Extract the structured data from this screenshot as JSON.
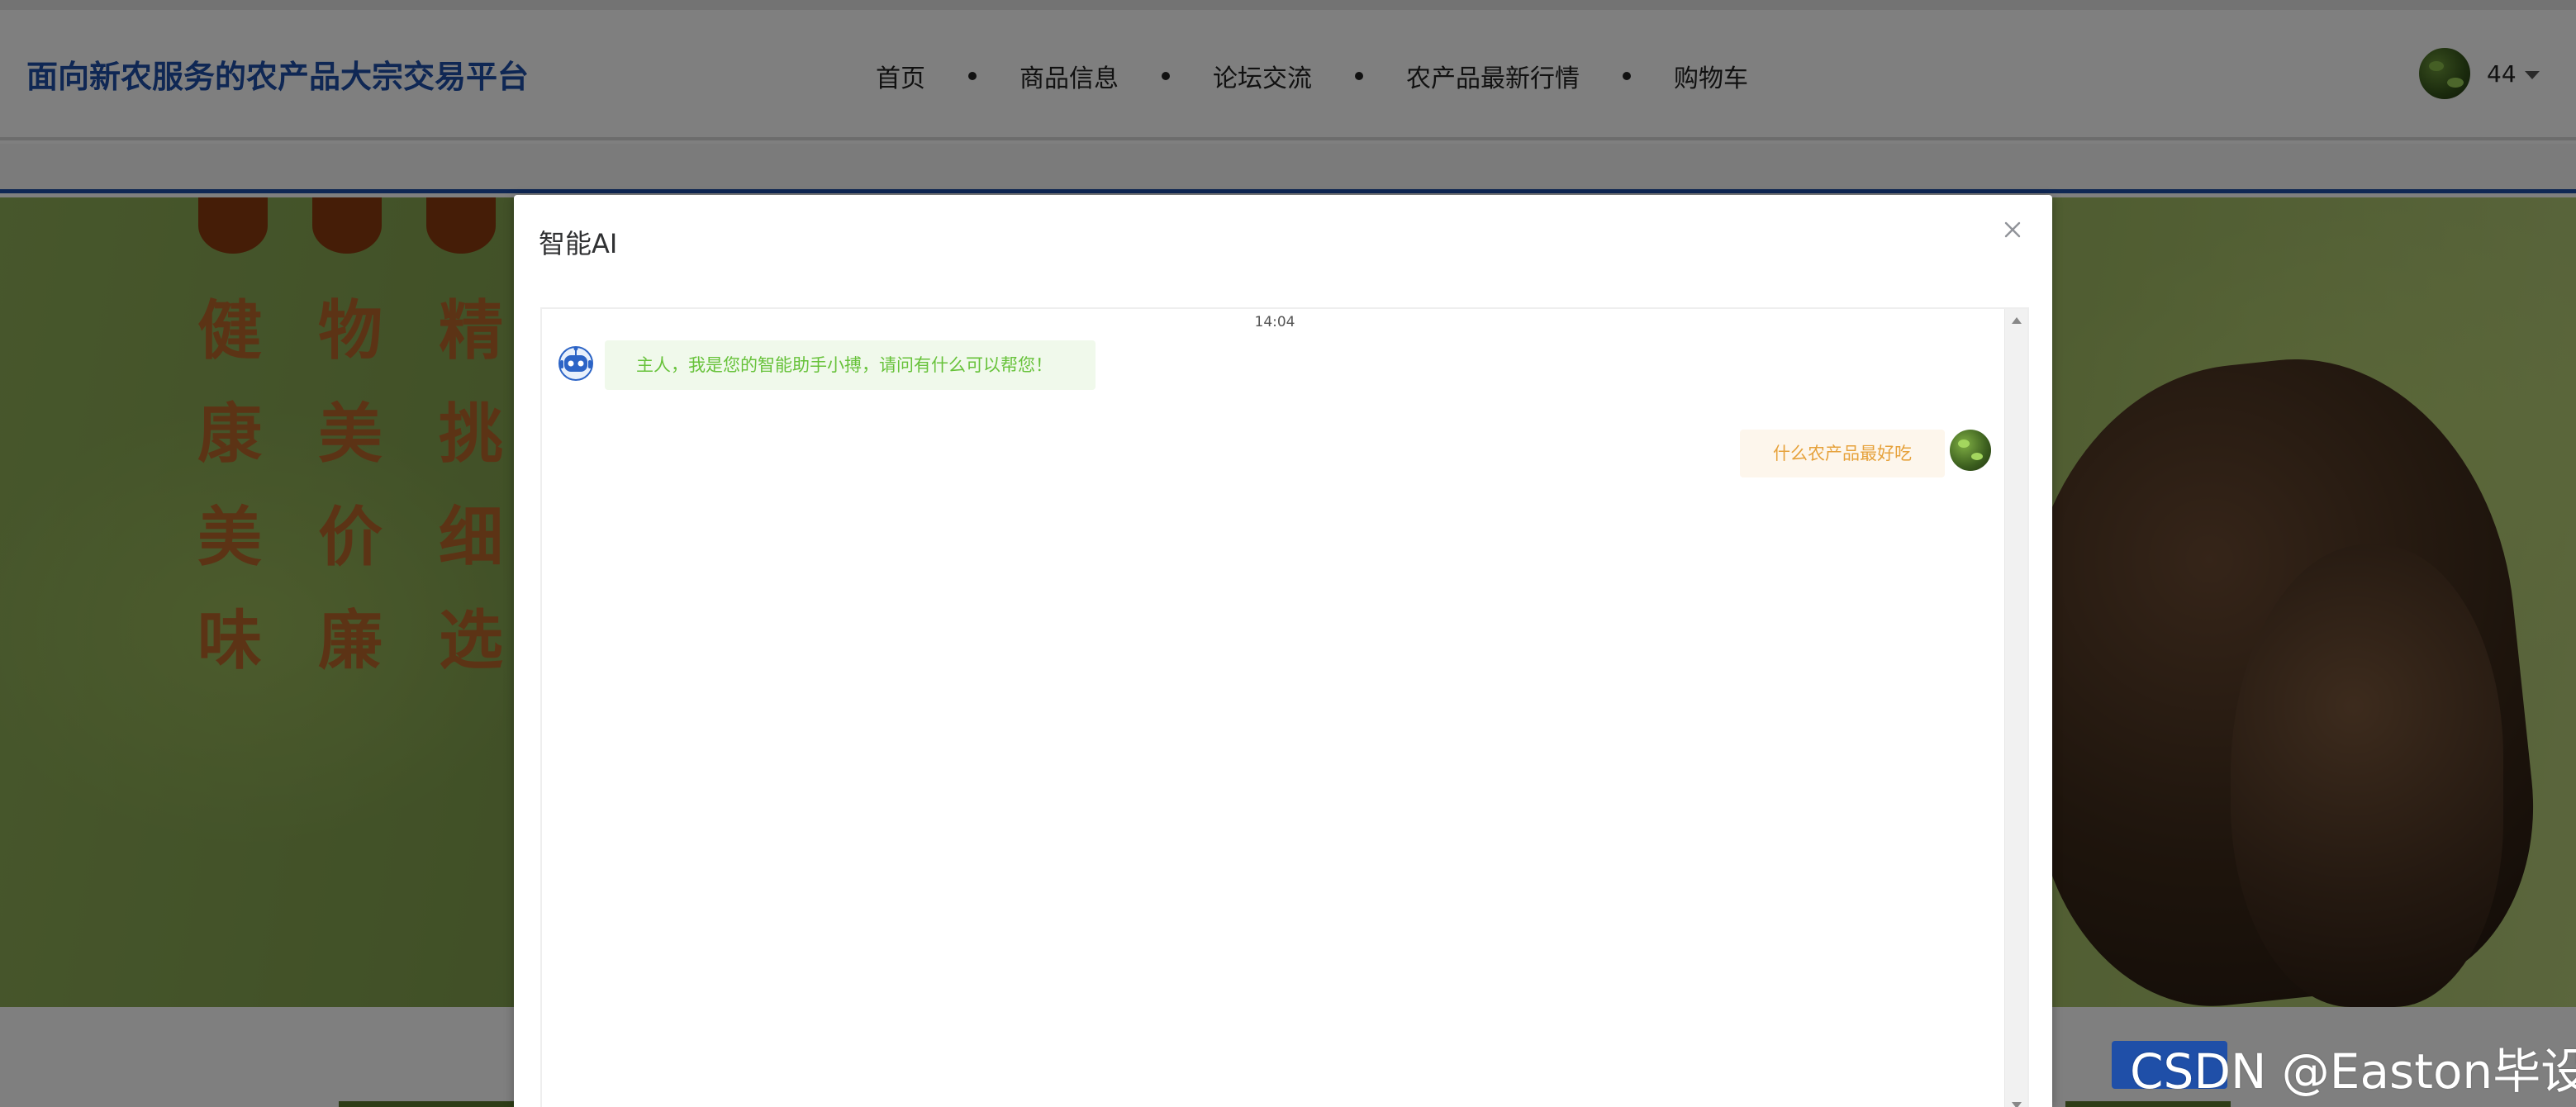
{
  "header": {
    "site_title": "面向新农服务的农产品大宗交易平台",
    "nav": [
      "首页",
      "商品信息",
      "论坛交流",
      "农产品最新行情",
      "购物车"
    ],
    "user_name": "44"
  },
  "banner": {
    "slogan_columns": [
      [
        "健",
        "康",
        "美",
        "味"
      ],
      [
        "物",
        "美",
        "价",
        "廉"
      ],
      [
        "精",
        "挑",
        "细",
        "选"
      ]
    ]
  },
  "dialog": {
    "title": "智能AI",
    "chat": {
      "time": "14:04",
      "bot_message": "主人，我是您的智能助手小搏，请问有什么可以帮您！",
      "user_message": "什么农产品最好吃"
    }
  },
  "watermark": "CSDN @Easton毕设",
  "colors": {
    "brand_blue": "#1f4fa8",
    "bot_bubble_bg": "#f0f9eb",
    "bot_bubble_text": "#67c23a",
    "user_bubble_bg": "#fdf6ec",
    "user_bubble_text": "#e6a23c"
  }
}
